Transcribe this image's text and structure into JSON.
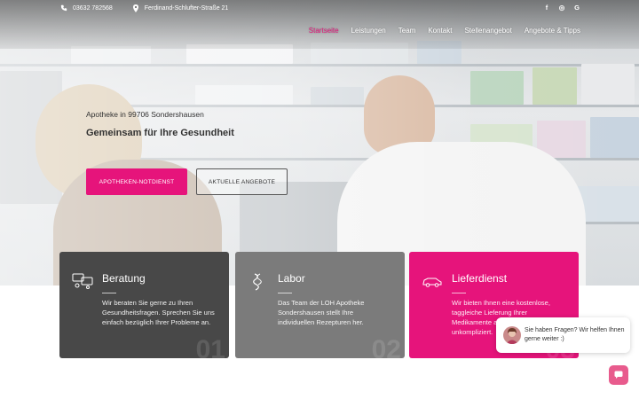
{
  "topbar": {
    "phone": "03632 782568",
    "address": "Ferdinand-Schlufter-Straße 21",
    "social": [
      {
        "icon": "facebook-icon",
        "glyph": "f"
      },
      {
        "icon": "instagram-icon",
        "glyph": "◎"
      },
      {
        "icon": "google-icon",
        "glyph": "G"
      }
    ]
  },
  "nav": {
    "items": [
      "Startseite",
      "Leistungen",
      "Team",
      "Kontakt",
      "Stellenangebot",
      "Angebote & Tipps"
    ],
    "active_index": 0
  },
  "hero": {
    "subtitle": "Apotheke in 99706 Sondershausen",
    "title": "Gemeinsam für Ihre Gesundheit",
    "primary_button": "APOTHEKEN-NOTDIENST",
    "secondary_button": "AKTUELLE ANGEBOTE"
  },
  "cards": [
    {
      "title": "Beratung",
      "text": "Wir beraten Sie gerne zu Ihren Gesundheitsfragen. Sprechen Sie uns einfach bezüglich Ihrer Probleme an.",
      "number": "01",
      "icon": "consultation-icon"
    },
    {
      "title": "Labor",
      "text": "Das Team der LOH Apotheke Sondershausen stellt Ihre individuellen Rezepturen her.",
      "number": "02",
      "icon": "laboratory-icon"
    },
    {
      "title": "Lieferdienst",
      "text": "Wir bieten Ihnen eine kostenlose, taggleiche Lieferung Ihrer Medikamente an. Schnell und unkompliziert.",
      "number": "03",
      "icon": "delivery-car-icon"
    }
  ],
  "chat": {
    "message": "Sie haben Fragen? Wir helfen Ihnen gerne weiter :)"
  },
  "colors": {
    "accent": "#e6147b",
    "card_dark": "#484848",
    "card_mid": "#7b7b7b"
  }
}
